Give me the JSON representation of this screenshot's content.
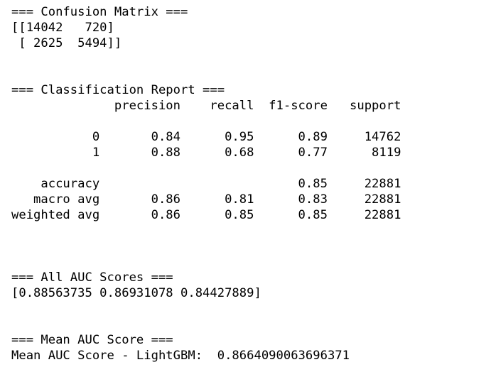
{
  "confusion_matrix": {
    "header": "=== Confusion Matrix ===",
    "row_1": "[[14042   720]",
    "row_2": " [ 2625  5494]]"
  },
  "classification_report": {
    "header": "=== Classification Report ===",
    "columns_line": "              precision    recall  f1-score   support",
    "class_0_line": "           0       0.84      0.95      0.89     14762",
    "class_1_line": "           1       0.88      0.68      0.77      8119",
    "accuracy_line": "    accuracy                           0.85     22881",
    "macro_avg_line": "   macro avg       0.86      0.81      0.83     22881",
    "weighted_avg_line": "weighted avg       0.86      0.85      0.85     22881"
  },
  "all_auc": {
    "header": "=== All AUC Scores ===",
    "values_line": "[0.88563735 0.86931078 0.84427889]"
  },
  "mean_auc": {
    "header": "=== Mean AUC Score ===",
    "value_line": "Mean AUC Score - LightGBM:  0.8664090063696371"
  }
}
